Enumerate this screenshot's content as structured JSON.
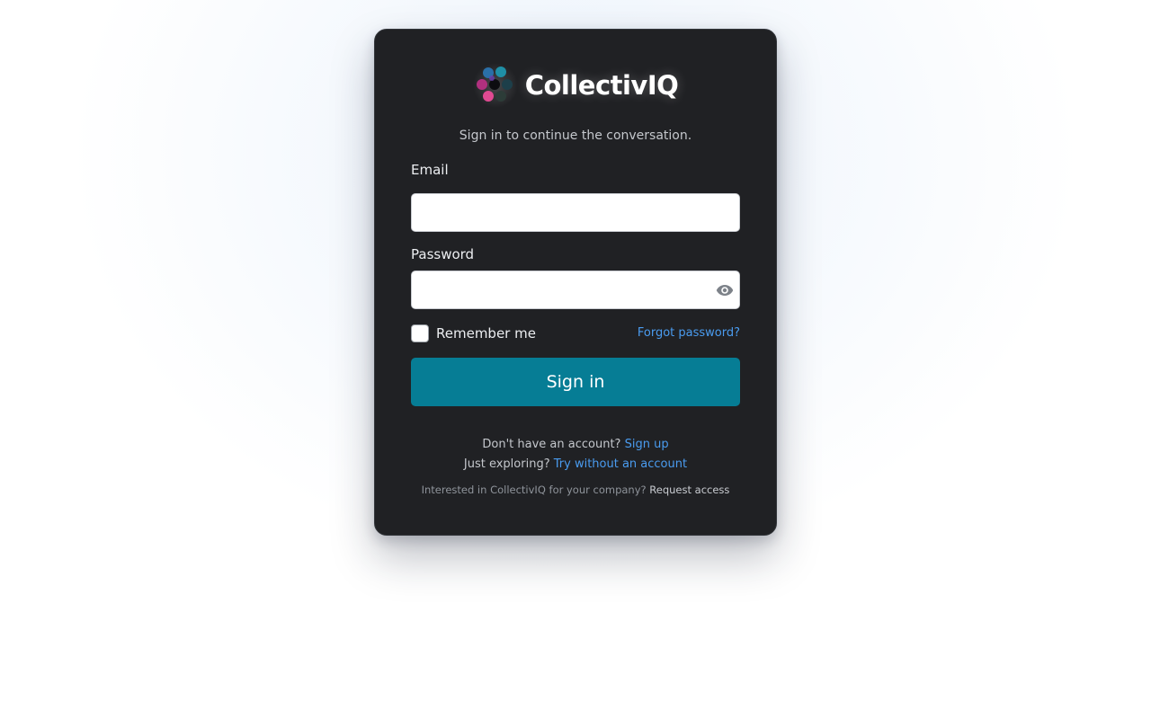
{
  "brand": {
    "name": "CollectivIQ",
    "logo_icon": "hexagon-cluster-logo-icon"
  },
  "login": {
    "subtitle": "Sign in to continue the conversation.",
    "email_label": "Email",
    "email_value": "",
    "password_label": "Password",
    "password_value": "",
    "password_toggle_icon": "eye-icon",
    "remember_label": "Remember me",
    "remember_checked": false,
    "forgot_link": "Forgot password?",
    "submit_label": "Sign in"
  },
  "footer": {
    "signup_prompt": "Don't have an account?",
    "signup_link": "Sign up",
    "explore_prompt": "Just exploring?",
    "explore_link": "Try without an account",
    "company_prompt": "Interested in CollectivIQ for your company?",
    "company_link": "Request access"
  },
  "colors": {
    "card_background": "#202124",
    "primary_button": "#067d95",
    "link": "#4a9cf0"
  }
}
